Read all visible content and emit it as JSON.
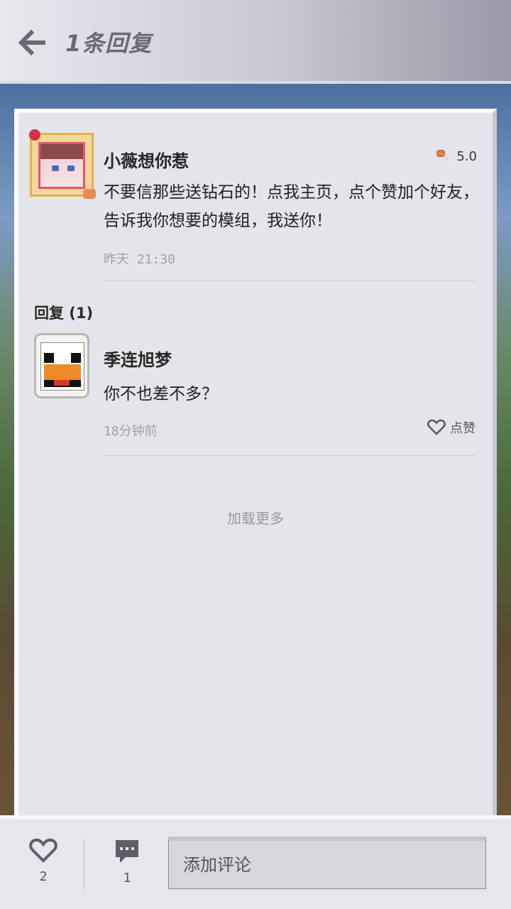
{
  "header": {
    "title": "1条回复"
  },
  "post": {
    "author": "小薇想你惹",
    "rating": "5.0",
    "content": "不要信那些送钻石的！点我主页，点个赞加个好友，告诉我你想要的模组，我送你！",
    "time": "昨天 21:30"
  },
  "replies": {
    "header": "回复 (1)",
    "items": [
      {
        "author": "季连旭梦",
        "content": "你不也差不多？",
        "time": "18分钟前",
        "like_label": "点赞"
      }
    ]
  },
  "load_more": "加载更多",
  "bottom": {
    "like_count": "2",
    "comment_count": "1",
    "input_placeholder": "添加评论"
  },
  "icons": {
    "back": "arrow-left-icon",
    "rating": "drumstick-icon",
    "like": "heart-icon",
    "comment": "chat-icon"
  },
  "colors": {
    "card_bg": "#e4e5ea",
    "topbar_gradient_start": "#e9e8ee",
    "topbar_gradient_end": "#9b98a8",
    "muted_text": "#a0a0a6"
  }
}
